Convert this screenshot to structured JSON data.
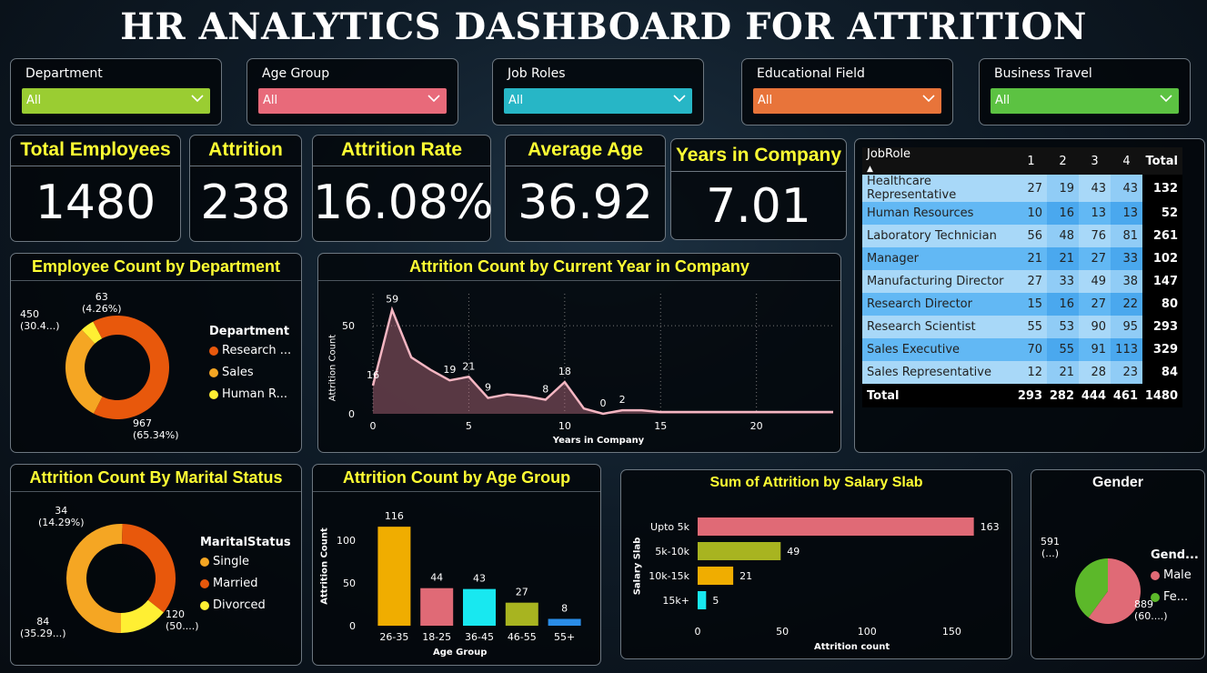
{
  "title": "HR  ANALYTICS DASHBOARD FOR ATTRITION",
  "slicers": [
    {
      "label": "Department",
      "value": "All",
      "color": "#9acd32"
    },
    {
      "label": "Age Group",
      "value": "All",
      "color": "#e86a7a"
    },
    {
      "label": "Job Roles",
      "value": "All",
      "color": "#27b6c6"
    },
    {
      "label": "Educational Field",
      "value": "All",
      "color": "#e8743a"
    },
    {
      "label": "Business Travel",
      "value": "All",
      "color": "#5cc242"
    }
  ],
  "kpis": [
    {
      "label": "Total Employees",
      "value": "1480"
    },
    {
      "label": "Attrition",
      "value": "238"
    },
    {
      "label": "Attrition Rate",
      "value": "16.08%"
    },
    {
      "label": "Average Age",
      "value": "36.92"
    },
    {
      "label": "Years in Company",
      "value": "7.01"
    }
  ],
  "dept_chart": {
    "title": "Employee Count by Department",
    "legend_title": "Department",
    "legend": [
      "Research ...",
      "Sales",
      "Human R..."
    ],
    "labels": [
      {
        "value": "63",
        "pct": "(4.26%)"
      },
      {
        "value": "450",
        "pct": "(30.4...)"
      },
      {
        "value": "967",
        "pct": "(65.34%)"
      }
    ]
  },
  "marital_chart": {
    "title": "Attrition Count By Marital Status",
    "legend_title": "MaritalStatus",
    "legend": [
      "Single",
      "Married",
      "Divorced"
    ],
    "labels": [
      {
        "value": "34",
        "pct": "(14.29%)"
      },
      {
        "value": "84",
        "pct": "(35.29...)"
      },
      {
        "value": "120",
        "pct": "(50....)"
      }
    ]
  },
  "year_chart": {
    "title": "Attrition Count by Current Year in Company",
    "xlabel": "Years in Company",
    "ylabel": "Attrition Count"
  },
  "age_chart": {
    "title": "Attrition Count by Age Group",
    "xlabel": "Age Group",
    "ylabel": "Attrition Count"
  },
  "salary_chart": {
    "title": "Sum of Attrition by Salary Slab",
    "xlabel": "Attrition count",
    "ylabel": "Salary Slab"
  },
  "gender_chart": {
    "title": "Gender",
    "legend_title": "Gend...",
    "legend": [
      "Male",
      "Fe..."
    ],
    "labels": [
      {
        "value": "591",
        "pct": "(...)"
      },
      {
        "value": "889",
        "pct": "(60....)"
      }
    ]
  },
  "matrix": {
    "headers": [
      "JobRole",
      "1",
      "2",
      "3",
      "4",
      "Total"
    ],
    "rows": [
      {
        "role": "Healthcare Representative",
        "v": [
          "27",
          "19",
          "43",
          "43"
        ],
        "total": "132"
      },
      {
        "role": "Human Resources",
        "v": [
          "10",
          "16",
          "13",
          "13"
        ],
        "total": "52"
      },
      {
        "role": "Laboratory Technician",
        "v": [
          "56",
          "48",
          "76",
          "81"
        ],
        "total": "261"
      },
      {
        "role": "Manager",
        "v": [
          "21",
          "21",
          "27",
          "33"
        ],
        "total": "102"
      },
      {
        "role": "Manufacturing Director",
        "v": [
          "27",
          "33",
          "49",
          "38"
        ],
        "total": "147"
      },
      {
        "role": "Research Director",
        "v": [
          "15",
          "16",
          "27",
          "22"
        ],
        "total": "80"
      },
      {
        "role": "Research Scientist",
        "v": [
          "55",
          "53",
          "90",
          "95"
        ],
        "total": "293"
      },
      {
        "role": "Sales Executive",
        "v": [
          "70",
          "55",
          "91",
          "113"
        ],
        "total": "329"
      },
      {
        "role": "Sales Representative",
        "v": [
          "12",
          "21",
          "28",
          "23"
        ],
        "total": "84"
      }
    ],
    "total_row": {
      "label": "Total",
      "v": [
        "293",
        "282",
        "444",
        "461"
      ],
      "total": "1480"
    }
  },
  "chart_data": [
    {
      "type": "pie",
      "title": "Employee Count by Department",
      "categories": [
        "Research & Development",
        "Sales",
        "Human Resources"
      ],
      "values": [
        967,
        450,
        63
      ],
      "colors": [
        "#e8580c",
        "#f5a623",
        "#ffef33"
      ],
      "donut": true,
      "legend": "right"
    },
    {
      "type": "area",
      "title": "Attrition Count by Current Year in Company",
      "xlabel": "Years in Company",
      "ylabel": "Attrition Count",
      "x": [
        0,
        1,
        2,
        3,
        4,
        5,
        6,
        7,
        8,
        9,
        10,
        11,
        12,
        13,
        14,
        15,
        16,
        17,
        18,
        19,
        20,
        21,
        22,
        23,
        24
      ],
      "values": [
        16,
        59,
        32,
        25,
        19,
        21,
        9,
        11,
        10,
        8,
        18,
        3,
        0,
        2,
        2,
        1,
        1,
        1,
        1,
        1,
        1,
        1,
        1,
        1,
        1
      ],
      "data_labels": [
        {
          "x": 0,
          "y": 16
        },
        {
          "x": 1,
          "y": 59
        },
        {
          "x": 4,
          "y": 19
        },
        {
          "x": 5,
          "y": 21
        },
        {
          "x": 6,
          "y": 9
        },
        {
          "x": 9,
          "y": 8
        },
        {
          "x": 10,
          "y": 18
        },
        {
          "x": 12,
          "y": 0
        },
        {
          "x": 13,
          "y": 2
        }
      ],
      "xticks": [
        0,
        5,
        10,
        15,
        20
      ],
      "yticks": [
        0,
        50
      ],
      "xlim": [
        0,
        24
      ],
      "ylim": [
        0,
        65
      ],
      "color": "#f4b6c2"
    },
    {
      "type": "bar",
      "title": "Attrition Count by Age Group",
      "xlabel": "Age Group",
      "ylabel": "Attrition Count",
      "categories": [
        "26-35",
        "18-25",
        "36-45",
        "46-55",
        "55+"
      ],
      "values": [
        116,
        44,
        43,
        27,
        8
      ],
      "colors": [
        "#f0ad00",
        "#e06a76",
        "#18e8f0",
        "#a8b420",
        "#2a8de8"
      ],
      "yticks": [
        0,
        50,
        100
      ],
      "ylim": [
        0,
        130
      ]
    },
    {
      "type": "bar",
      "orientation": "horizontal",
      "title": "Sum of Attrition by Salary Slab",
      "xlabel": "Attrition count",
      "ylabel": "Salary Slab",
      "categories": [
        "Upto 5k",
        "5k-10k",
        "10k-15k",
        "15k+"
      ],
      "values": [
        163,
        49,
        21,
        5
      ],
      "colors": [
        "#e06a76",
        "#a8b420",
        "#f0ad00",
        "#18e8f0"
      ],
      "xticks": [
        0,
        50,
        100,
        150
      ],
      "xlim": [
        0,
        175
      ]
    },
    {
      "type": "pie",
      "title": "Gender",
      "categories": [
        "Male",
        "Female"
      ],
      "values": [
        889,
        591
      ],
      "colors": [
        "#e06a76",
        "#5cb82a"
      ],
      "legend": "right"
    },
    {
      "type": "pie",
      "title": "Attrition Count By Marital Status",
      "categories": [
        "Single",
        "Married",
        "Divorced"
      ],
      "values": [
        120,
        84,
        34
      ],
      "colors": [
        "#f5a623",
        "#e8580c",
        "#ffef33"
      ],
      "donut": true,
      "legend": "right"
    }
  ]
}
